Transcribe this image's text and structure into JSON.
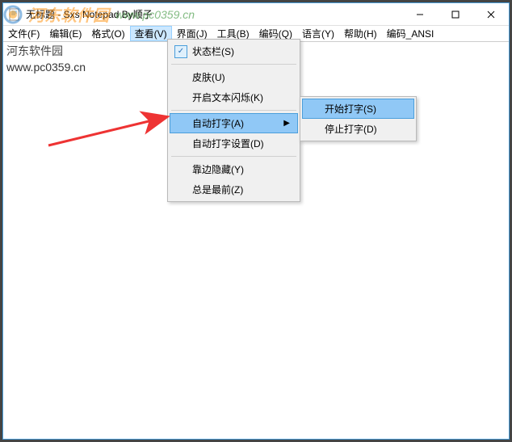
{
  "window": {
    "title": "无标题 - Sxs Notepad  By顺子"
  },
  "menubar": {
    "items": [
      "文件(F)",
      "编辑(E)",
      "格式(O)",
      "查看(V)",
      "界面(J)",
      "工具(B)",
      "编码(Q)",
      "语言(Y)",
      "帮助(H)",
      "编码_ANSI"
    ],
    "active_index": 3
  },
  "content": {
    "line1": "河东软件园",
    "line2": "www.pc0359.cn"
  },
  "watermark": {
    "text": "河东软件园",
    "url": "www.pc0359.cn"
  },
  "dropdown": {
    "items": [
      {
        "label": "状态栏(S)",
        "checked": true
      },
      {
        "sep": true
      },
      {
        "label": "皮肤(U)"
      },
      {
        "label": "开启文本闪烁(K)"
      },
      {
        "sep": true
      },
      {
        "label": "自动打字(A)",
        "submenu": true,
        "highlight": true
      },
      {
        "label": "自动打字设置(D)"
      },
      {
        "sep": true
      },
      {
        "label": "靠边隐藏(Y)"
      },
      {
        "label": "总是最前(Z)"
      }
    ]
  },
  "submenu": {
    "items": [
      {
        "label": "开始打字(S)",
        "highlight": true
      },
      {
        "label": "停止打字(D)"
      }
    ]
  }
}
